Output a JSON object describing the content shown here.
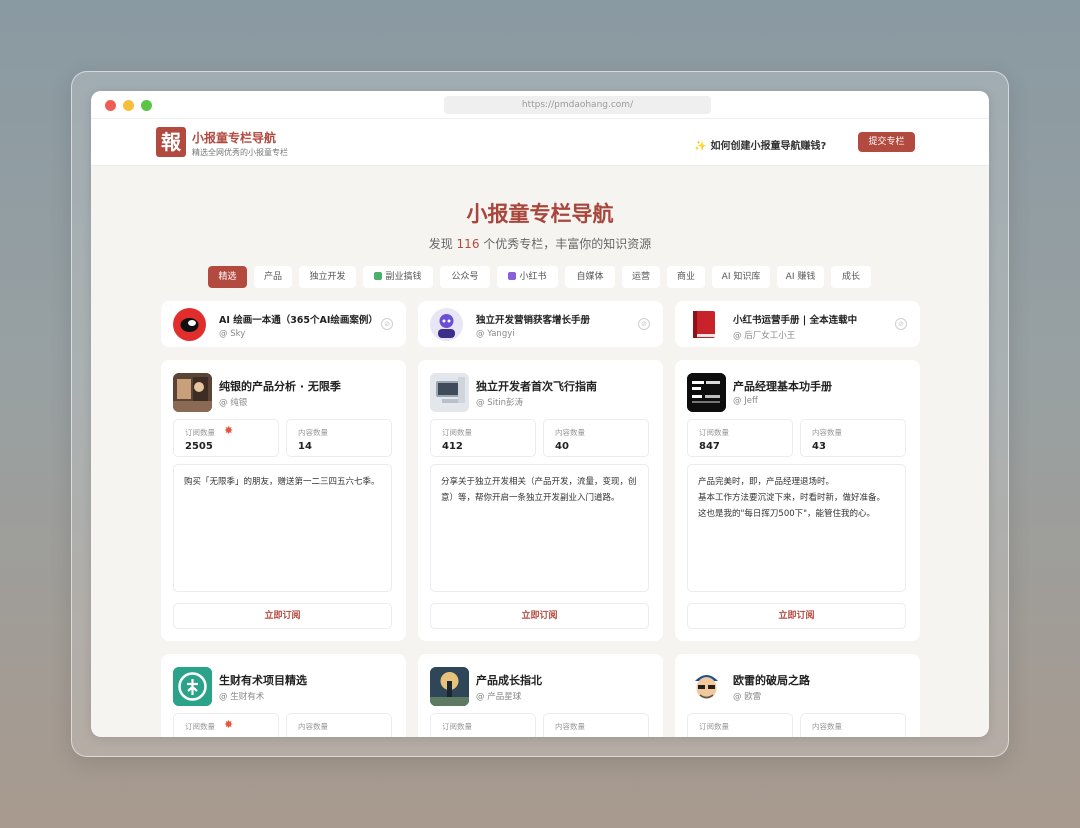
{
  "browser": {
    "url": "https://pmdaohang.com/"
  },
  "header": {
    "logo_char": "報",
    "site_title": "小报童专栏导航",
    "site_subtitle": "精选全网优秀的小报童专栏",
    "earn_link_icon": "sparkle-icon",
    "earn_link": "如何创建小报童导航赚钱?",
    "submit_button": "提交专栏"
  },
  "hero": {
    "title": "小报童专栏导航",
    "subtitle_pre": "发现 ",
    "count": "116",
    "subtitle_post": " 个优秀专栏，丰富你的知识资源"
  },
  "tabs": [
    {
      "label": "精选",
      "active": true
    },
    {
      "label": "产品"
    },
    {
      "label": "独立开发"
    },
    {
      "label": "副业搞钱",
      "icon": "money-icon"
    },
    {
      "label": "公众号"
    },
    {
      "label": "小红书",
      "icon": "heart-icon"
    },
    {
      "label": "自媒体"
    },
    {
      "label": "运营"
    },
    {
      "label": "商业"
    },
    {
      "label": "AI 知识库"
    },
    {
      "label": "AI 赚钱"
    },
    {
      "label": "成长"
    }
  ],
  "featured": [
    {
      "title": "AI 绘画一本通（365个AI绘画案例）",
      "author": "@ Sky"
    },
    {
      "title": "独立开发营销获客增长手册",
      "author": "@ Yangyi"
    },
    {
      "title": "小红书运营手册 | 全本连载中",
      "author": "@ 后厂女工小王"
    }
  ],
  "stats_labels": {
    "subscribers": "订阅数量",
    "contents": "内容数量"
  },
  "subscribe_label": "立即订阅",
  "columns": [
    {
      "title": "纯银的产品分析 · 无限季",
      "author": "@ 纯银",
      "subscribers": "2505",
      "contents": "14",
      "hot": true,
      "desc": "购买「无限季」的朋友，赠送第一二三四五六七季。"
    },
    {
      "title": "独立开发者首次飞行指南",
      "author": "@ Sitin彭涛",
      "subscribers": "412",
      "contents": "40",
      "hot": false,
      "desc": "分享关于独立开发相关（产品开发，流量，变现，创意）等，帮你开启一条独立开发副业入门道路。"
    },
    {
      "title": "产品经理基本功手册",
      "author": "@ Jeff",
      "subscribers": "847",
      "contents": "43",
      "hot": false,
      "desc": "产品完美时，即，产品经理退场时。\n基本工作方法要沉淀下来，时看时新，做好准备。\n这也是我的\"每日挥刀500下\"，能管住我的心。"
    },
    {
      "title": "生财有术项目精选",
      "author": "@ 生财有术",
      "hot": true
    },
    {
      "title": "产品成长指北",
      "author": "@ 产品星球",
      "hot": false
    },
    {
      "title": "欧雷的破局之路",
      "author": "@ 欧雷",
      "hot": false
    }
  ],
  "colors": {
    "brand": "#b34a40",
    "background": "#f6f4f1"
  }
}
